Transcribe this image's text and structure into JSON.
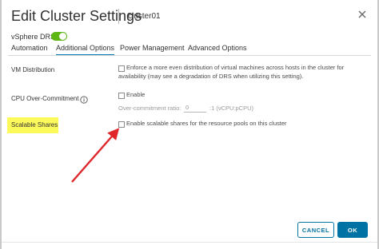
{
  "dialog": {
    "title": "Edit Cluster Settings",
    "subtitle": "cluster01",
    "close_icon": "close-icon"
  },
  "drs": {
    "label": "vSphere DRS",
    "enabled": true,
    "accent": "#5eb715"
  },
  "tabs": [
    {
      "label": "Automation",
      "active": false
    },
    {
      "label": "Additional Options",
      "active": true
    },
    {
      "label": "Power Management",
      "active": false
    },
    {
      "label": "Advanced Options",
      "active": false
    }
  ],
  "options": {
    "vm_distribution": {
      "label": "VM Distribution",
      "checked": false,
      "text_line1": "Enforce a more even distribution of virtual machines across hosts in the cluster for",
      "text_line2": "availability (may see a degradation of DRS when utilizing this setting)."
    },
    "cpu_overcommit": {
      "label": "CPU Over-Commitment",
      "info_icon": "info-icon",
      "checked": false,
      "text": "Enable",
      "ratio_label": "Over-commitment ratio:",
      "ratio_value": "0",
      "ratio_suffix": ":1 (vCPU:pCPU)"
    },
    "scalable_shares": {
      "label": "Scalable Shares",
      "highlight_color": "#fcf95b",
      "checked": false,
      "text": "Enable scalable shares for the resource pools on this cluster"
    }
  },
  "annotation": {
    "arrow_color": "#e0262b"
  },
  "footer": {
    "cancel_label": "CANCEL",
    "ok_label": "OK",
    "primary_color": "#0072a3"
  }
}
